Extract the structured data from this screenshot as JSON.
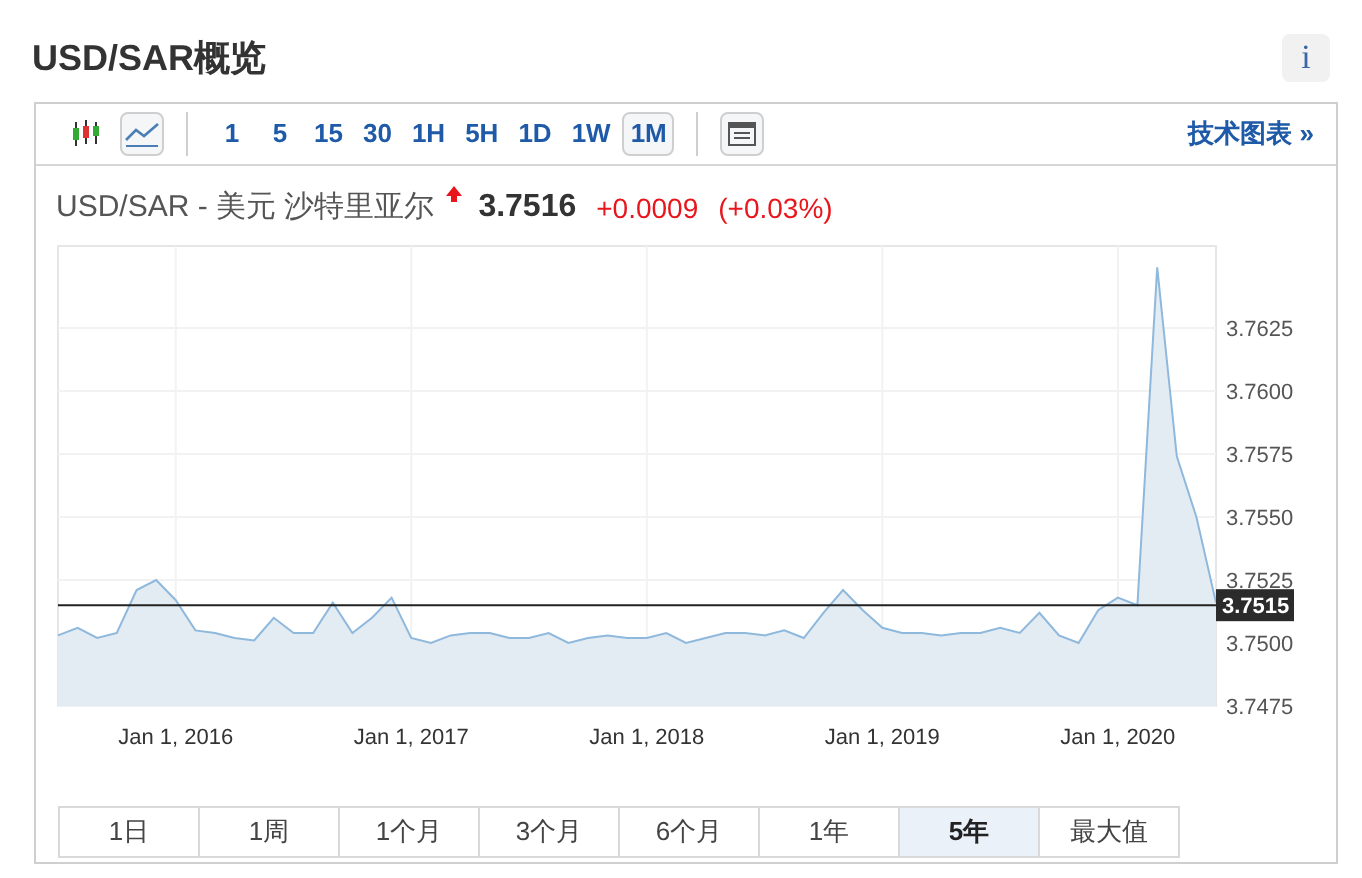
{
  "title": "USD/SAR概览",
  "info_button": "i",
  "toolbar": {
    "chart_types": [
      {
        "kind": "candlestick",
        "selected": false
      },
      {
        "kind": "line",
        "selected": true
      }
    ],
    "intervals": [
      {
        "label": "1",
        "selected": false
      },
      {
        "label": "5",
        "selected": false
      },
      {
        "label": "15",
        "selected": false
      },
      {
        "label": "30",
        "selected": false
      },
      {
        "label": "1H",
        "selected": false
      },
      {
        "label": "5H",
        "selected": false
      },
      {
        "label": "1D",
        "selected": false
      },
      {
        "label": "1W",
        "selected": false
      },
      {
        "label": "1M",
        "selected": true
      }
    ],
    "technical_link": "技术图表 »"
  },
  "quote": {
    "name": "USD/SAR - 美元 沙特里亚尔",
    "rising": true,
    "price": "3.7516",
    "change": "+0.0009",
    "change_percent": "(+0.03%)"
  },
  "chart": {
    "chart_data": {
      "type": "area",
      "grid": true,
      "ref_lines": [
        {
          "axis": "y",
          "value": 3.7515,
          "label": "3.7515"
        }
      ],
      "categories": [
        null,
        null,
        null,
        null,
        null,
        null,
        "Jan 1, 2016",
        null,
        null,
        null,
        null,
        null,
        null,
        null,
        null,
        null,
        null,
        null,
        "Jan 1, 2017",
        null,
        null,
        null,
        null,
        null,
        null,
        null,
        null,
        null,
        null,
        null,
        "Jan 1, 2018",
        null,
        null,
        null,
        null,
        null,
        null,
        null,
        null,
        null,
        null,
        null,
        "Jan 1, 2019",
        null,
        null,
        null,
        null,
        null,
        null,
        null,
        null,
        null,
        null,
        null,
        "Jan 1, 2020",
        null,
        null,
        null,
        null,
        null
      ],
      "values": [
        3.7503,
        3.7506,
        3.7502,
        3.7504,
        3.7521,
        3.7525,
        3.7517,
        3.7505,
        3.7504,
        3.7502,
        3.7501,
        3.751,
        3.7504,
        3.7504,
        3.7516,
        3.7504,
        3.751,
        3.7518,
        3.7502,
        3.75,
        3.7503,
        3.7504,
        3.7504,
        3.7502,
        3.7502,
        3.7504,
        3.75,
        3.7502,
        3.7503,
        3.7502,
        3.7502,
        3.7504,
        3.75,
        3.7502,
        3.7504,
        3.7504,
        3.7503,
        3.7505,
        3.7502,
        3.7512,
        3.7521,
        3.7513,
        3.7506,
        3.7504,
        3.7504,
        3.7503,
        3.7504,
        3.7504,
        3.7506,
        3.7504,
        3.7512,
        3.7503,
        3.75,
        3.7513,
        3.7518,
        3.7515,
        3.7649,
        3.7574,
        3.755,
        3.7516
      ],
      "ylim": [
        3.7475,
        3.76575
      ],
      "yticks": [
        {
          "value": 3.7475,
          "label": "3.7475"
        },
        {
          "value": 3.75,
          "label": "3.7500"
        },
        {
          "value": 3.7525,
          "label": "3.7525"
        },
        {
          "value": 3.755,
          "label": "3.7550"
        },
        {
          "value": 3.7575,
          "label": "3.7575"
        },
        {
          "value": 3.76,
          "label": "3.7600"
        },
        {
          "value": 3.7625,
          "label": "3.7625"
        }
      ]
    }
  },
  "ranges": [
    {
      "label": "1日",
      "selected": false
    },
    {
      "label": "1周",
      "selected": false
    },
    {
      "label": "1个月",
      "selected": false
    },
    {
      "label": "3个月",
      "selected": false
    },
    {
      "label": "6个月",
      "selected": false
    },
    {
      "label": "1年",
      "selected": false
    },
    {
      "label": "5年",
      "selected": true
    },
    {
      "label": "最大值",
      "selected": false
    }
  ]
}
